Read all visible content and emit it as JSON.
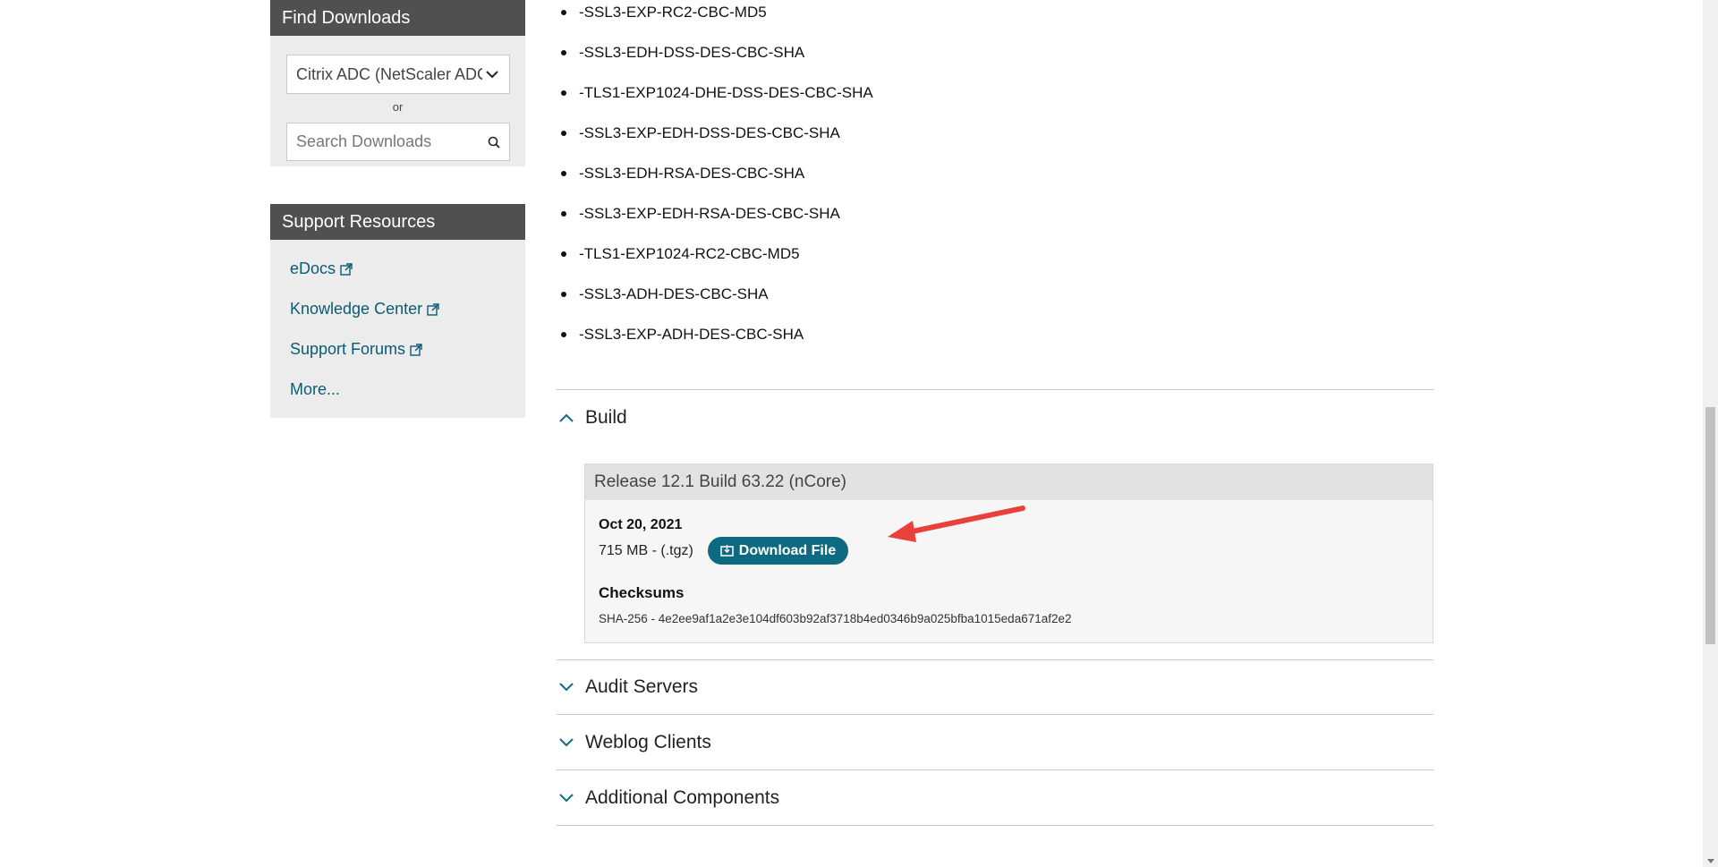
{
  "sidebar": {
    "find_downloads": {
      "title": "Find Downloads",
      "product_select": "Citrix ADC (NetScaler ADC)",
      "or_label": "or",
      "search_placeholder": "Search Downloads"
    },
    "support_resources": {
      "title": "Support Resources",
      "links": [
        {
          "label": "eDocs",
          "external": true
        },
        {
          "label": "Knowledge Center",
          "external": true
        },
        {
          "label": "Support Forums",
          "external": true
        },
        {
          "label": "More...",
          "external": false
        }
      ]
    }
  },
  "cipher_list": [
    "-SSL3-EXP-RC2-CBC-MD5",
    "-SSL3-EDH-DSS-DES-CBC-SHA",
    "-TLS1-EXP1024-DHE-DSS-DES-CBC-SHA",
    "-SSL3-EXP-EDH-DSS-DES-CBC-SHA",
    "-SSL3-EDH-RSA-DES-CBC-SHA",
    "-SSL3-EXP-EDH-RSA-DES-CBC-SHA",
    "-TLS1-EXP1024-RC2-CBC-MD5",
    "-SSL3-ADH-DES-CBC-SHA",
    "-SSL3-EXP-ADH-DES-CBC-SHA"
  ],
  "sections": {
    "build": {
      "label": "Build",
      "expanded": true,
      "release_title": "Release 12.1 Build 63.22 (nCore)",
      "date": "Oct 20, 2021",
      "size": "715 MB - (.tgz)",
      "download_label": "Download File",
      "checksums_title": "Checksums",
      "checksum": "SHA-256 - 4e2ee9af1a2e3e104df603b92af3718b4ed0346b9a025bfba1015eda671af2e2"
    },
    "audit_servers": {
      "label": "Audit Servers",
      "expanded": false
    },
    "weblog_clients": {
      "label": "Weblog Clients",
      "expanded": false
    },
    "additional_components": {
      "label": "Additional Components",
      "expanded": false
    }
  },
  "colors": {
    "panel_header": "#505050",
    "panel_bg": "#ececec",
    "link": "#0b5c73",
    "accent": "#0e6a80",
    "annotation_arrow": "#e8413a"
  }
}
